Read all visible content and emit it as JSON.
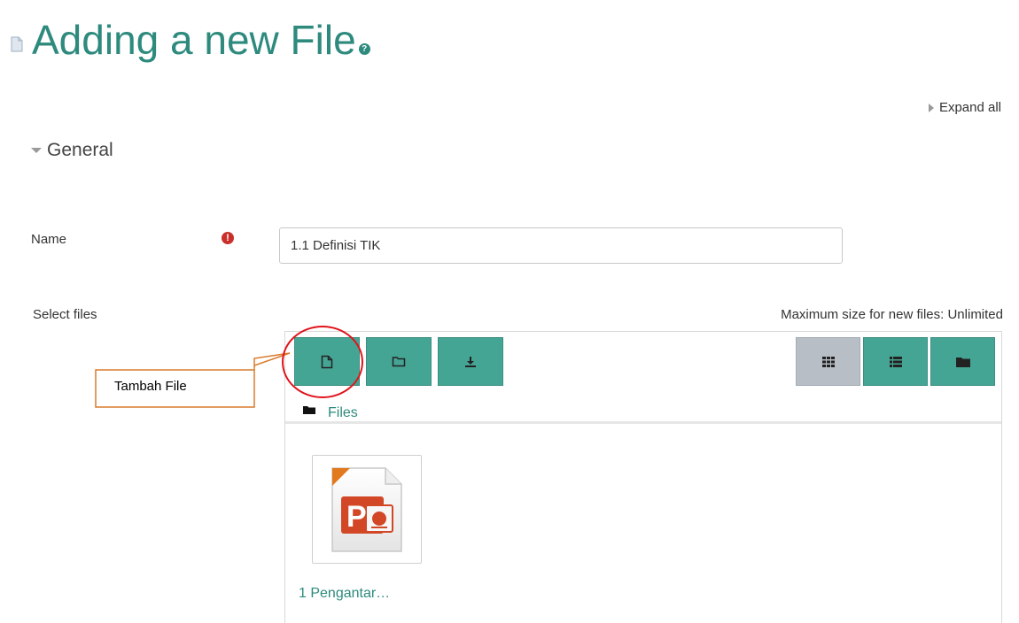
{
  "page": {
    "title": "Adding a new File",
    "expand_all": "Expand all",
    "section_general": "General"
  },
  "form": {
    "name_label": "Name",
    "name_value": "1.1 Definisi TIK",
    "select_files_label": "Select files",
    "max_size_text": "Maximum size for new files: Unlimited"
  },
  "filepicker": {
    "toolbar_buttons": [
      "add-file-icon",
      "create-folder-icon",
      "download-icon"
    ],
    "view_buttons": [
      "grid-view-icon",
      "list-view-icon",
      "tree-view-icon"
    ],
    "active_view": "grid-view-icon",
    "breadcrumb_root": "Files",
    "files": [
      {
        "name": "1 Pengantar…",
        "type": "powerpoint-file-icon"
      }
    ]
  },
  "annotation": {
    "callout_text": "Tambah File",
    "circle_color": "#e0141c",
    "callout_border_color": "#d97a2b"
  },
  "colors": {
    "accent": "#2d8a7d",
    "button": "#45a594",
    "button_active": "#b7bec6",
    "required": "#c9302c"
  }
}
